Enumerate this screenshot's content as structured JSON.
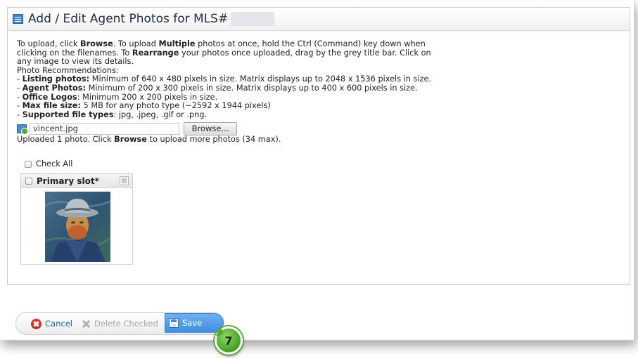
{
  "dialog": {
    "title": "Add / Edit Agent Photos for MLS#",
    "title_icon": "form-icon"
  },
  "instructions": {
    "p1_a": "To upload, click ",
    "p1_browse": "Browse",
    "p1_b": ". To upload ",
    "p1_multiple": "Multiple",
    "p1_c": " photos at once, hold the Ctrl (Command) key down when",
    "p1_d": "clicking on the filenames. To ",
    "p1_rearrange": "Rearrange",
    "p1_e": " your photos once uploaded, drag by the grey title bar. Click on",
    "p1_f": "any image to view its details.",
    "rec_heading": "Photo Recommendations:",
    "recommendations": [
      {
        "prefix": "- ",
        "label": "Listing photos:",
        "text": " Minimum of 640 x 480 pixels in size. Matrix displays up to 2048 x 1536 pixels in size."
      },
      {
        "prefix": "- ",
        "label": "Agent Photos:",
        "text": " Minimum of 200 x 300 pixels in size. Matrix displays up to 400 x 600 pixels in size."
      },
      {
        "prefix": "- ",
        "label": "Office Logos",
        "text": ": Minimum 200 x 200 pixels in size."
      },
      {
        "prefix": "- ",
        "label": "Max file size:",
        "text": " 5 MB for any photo type (~2592 x 1944 pixels)"
      },
      {
        "prefix": "- ",
        "label": "Supported file types",
        "text": ": jpg, .jpeg, .gif or .png."
      }
    ]
  },
  "upload": {
    "file_value": "vincent.jpg",
    "browse_label": "Browse...",
    "status_a": "Uploaded 1 photo. Click ",
    "status_browse": "Browse",
    "status_b": " to upload more photos (34 max)."
  },
  "photos": {
    "check_all_label": "Check All",
    "slots": [
      {
        "label": "Primary slot*",
        "image": "portrait-thumbnail"
      }
    ]
  },
  "footer": {
    "cancel_label": "Cancel",
    "delete_label": "Delete Checked",
    "save_label": "Save"
  },
  "step_badge": "7",
  "colors": {
    "accent_blue": "#3f8fe0",
    "cancel_red": "#d9382c",
    "badge_green": "#3e9a1e",
    "link_blue": "#1e62a8"
  }
}
